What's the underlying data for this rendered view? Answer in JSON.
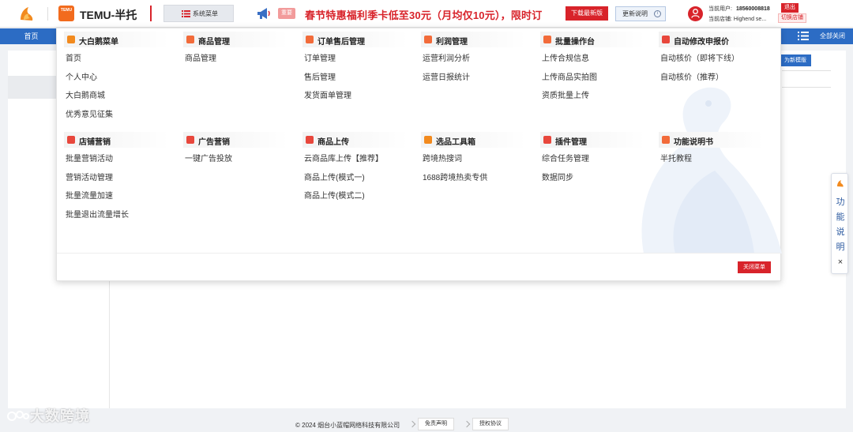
{
  "header": {
    "brand": "TEMU-半托",
    "temu_badge": "TEMU",
    "system_menu_label": "系统菜单",
    "promo_tag": "重要",
    "promo_text": "春节特惠福利季卡低至30元（月均仅10元），限时订",
    "download_label": "下载最新版",
    "update_label": "更新说明",
    "user_label": "当前用户:",
    "user_phone": "18560008818",
    "shop_label": "当前店铺:",
    "shop_name": "Highend se...",
    "logout_label": "退出",
    "switch_shop_label": "切换店铺"
  },
  "navbar": {
    "home_tab": "首页",
    "close_all": "全部关闭"
  },
  "background": {
    "new_layout_button": "为新模版"
  },
  "mega_menu": {
    "columns_row1": [
      {
        "title": "大白鹅菜单",
        "icon": "swan-icon",
        "color": "#f28a1e",
        "items": [
          "首页",
          "个人中心",
          "大白鹅商城",
          "优秀意见征集"
        ]
      },
      {
        "title": "商品管理",
        "icon": "product-icon",
        "color": "#f26b3a",
        "items": [
          "商品管理"
        ]
      },
      {
        "title": "订单售后管理",
        "icon": "order-icon",
        "color": "#f26b3a",
        "items": [
          "订单管理",
          "售后管理",
          "发货面单管理"
        ]
      },
      {
        "title": "利润管理",
        "icon": "profit-icon",
        "color": "#f26b3a",
        "items": [
          "运营利润分析",
          "运营日报统计"
        ]
      },
      {
        "title": "批量操作台",
        "icon": "batch-icon",
        "color": "#f26b3a",
        "items": [
          "上传合规信息",
          "上传商品实拍图",
          "资质批量上传"
        ]
      },
      {
        "title": "自动修改申报价",
        "icon": "price-icon",
        "color": "#e8473c",
        "items": [
          "自动核价（即将下线）",
          "自动核价（推荐）"
        ]
      }
    ],
    "columns_row2": [
      {
        "title": "店铺营销",
        "icon": "diamond-icon",
        "color": "#e8473c",
        "items": [
          "批量营销活动",
          "营销活动管理",
          "批量流量加速",
          "批量退出流量增长"
        ]
      },
      {
        "title": "广告营销",
        "icon": "diamond-icon",
        "color": "#e8473c",
        "items": [
          "一键广告投放"
        ]
      },
      {
        "title": "商品上传",
        "icon": "upload-icon",
        "color": "#e8473c",
        "items": [
          "云商品库上传【推荐】",
          "商品上传(模式一)",
          "商品上传(模式二)"
        ]
      },
      {
        "title": "选品工具箱",
        "icon": "toolbox-icon",
        "color": "#f28a1e",
        "items": [
          "跨境热搜词",
          "1688跨境热卖专供"
        ]
      },
      {
        "title": "插件管理",
        "icon": "plugin-icon",
        "color": "#e8473c",
        "items": [
          "综合任务管理",
          "数据同步"
        ]
      },
      {
        "title": "功能说明书",
        "icon": "manual-icon",
        "color": "#f26b3a",
        "items": [
          "半托教程"
        ]
      }
    ],
    "close_label": "关闭菜单"
  },
  "float_panel": {
    "text": "功能说明",
    "close": "×"
  },
  "footer": {
    "copyright": "© 2024 烟台小蓝帽网络科技有限公司",
    "disclaimer": "免责声明",
    "agreement": "授权协议"
  },
  "watermark": "大数跨境",
  "colors": {
    "brand_red": "#d8232a",
    "nav_blue": "#2c6cc4",
    "accent_orange": "#f28a1e"
  }
}
